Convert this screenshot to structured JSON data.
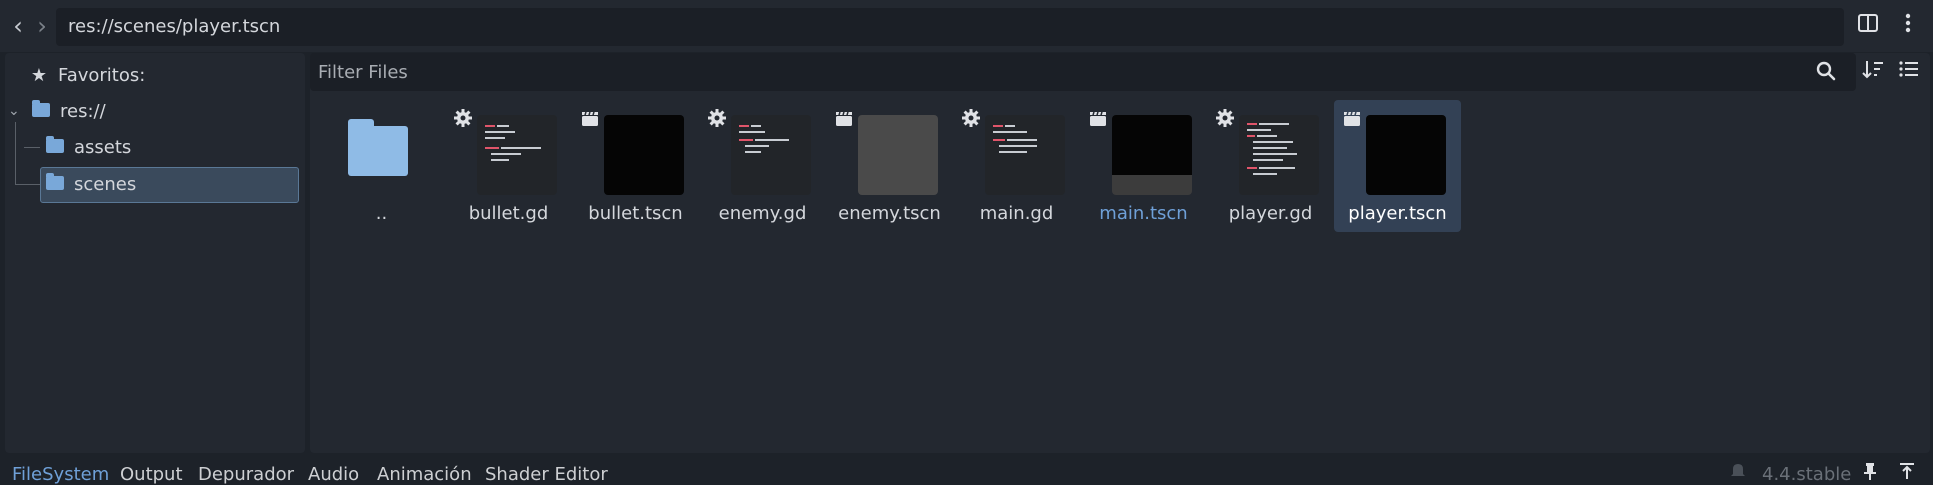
{
  "pathbar": {
    "path": "res://scenes/player.tscn",
    "back_icon": "chevron-left",
    "forward_icon": "chevron-right",
    "split_icon": "split-view",
    "menu_icon": "kebab-menu"
  },
  "tree": {
    "favorites_label": "Favoritos:",
    "root_label": "res://",
    "items": [
      {
        "label": "assets"
      },
      {
        "label": "scenes"
      }
    ]
  },
  "files": {
    "filter_placeholder": "Filter Files",
    "items": [
      {
        "label": "..",
        "kind": "folder"
      },
      {
        "label": "bullet.gd",
        "kind": "script"
      },
      {
        "label": "bullet.tscn",
        "kind": "scene"
      },
      {
        "label": "enemy.gd",
        "kind": "script"
      },
      {
        "label": "enemy.tscn",
        "kind": "scene"
      },
      {
        "label": "main.gd",
        "kind": "script"
      },
      {
        "label": "main.tscn",
        "kind": "scene"
      },
      {
        "label": "player.gd",
        "kind": "script"
      },
      {
        "label": "player.tscn",
        "kind": "scene"
      }
    ]
  },
  "bottom": {
    "tabs": [
      "FileSystem",
      "Output",
      "Depurador",
      "Audio",
      "Animación",
      "Shader Editor"
    ],
    "version": "4.4.stable"
  },
  "colors": {
    "accent": "#6fa0d8",
    "panel": "#232830",
    "background": "#1d2229",
    "selection": "#334155",
    "folder": "#8fbbe6"
  }
}
